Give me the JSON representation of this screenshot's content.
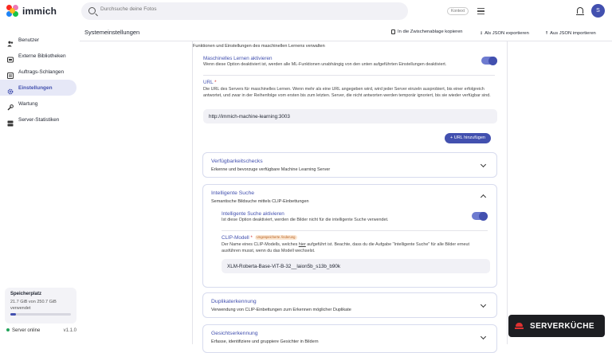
{
  "app": {
    "name": "immich"
  },
  "search": {
    "placeholder": "Durchsuche deine Fotos",
    "badge": "Kontext"
  },
  "user": {
    "avatar_letter": "S"
  },
  "sidebar": {
    "items": [
      {
        "label": "Benutzer",
        "icon": "users-icon"
      },
      {
        "label": "Externe Bibliotheken",
        "icon": "library-icon"
      },
      {
        "label": "Auftrags-Schlangen",
        "icon": "queue-icon"
      },
      {
        "label": "Einstellungen",
        "icon": "gear-icon",
        "active": true
      },
      {
        "label": "Wartung",
        "icon": "wrench-icon"
      },
      {
        "label": "Server-Statistiken",
        "icon": "server-icon"
      }
    ],
    "storage": {
      "title": "Speicherplatz",
      "usage": "21.7 GiB von 250.7 GiB verwendet",
      "fraction": 0.087
    },
    "server": {
      "status": "Server online",
      "version": "v1.1.0"
    }
  },
  "header": {
    "title": "Systemeinstellungen",
    "copy_label": "In die Zwischenablage kopieren",
    "export_label": "Als JSON exportieren",
    "import_label": "Aus JSON importieren"
  },
  "ml": {
    "intro": "Funktionen und Einstellungen des maschinellen Lernens verwalten",
    "enable_title": "Maschinelles Lernen aktivieren",
    "enable_desc": "Wenn diese Option deaktiviert ist, werden alle ML-Funktionen unabhängig von den unten aufgeführten Einstellungen deaktiviert.",
    "url_title": "URL",
    "url_desc": "Die URL des Servers für maschinelles Lernen. Wenn mehr als eine URL angegeben wird, wird jeder Server einzeln ausprobiert, bis einer erfolgreich antwortet, und zwar in der Reihenfolge vom ersten bis zum letzten. Server, die nicht antworten werden temporär ignoriert, bis sie wieder verfügbar sind.",
    "url_value": "http://immich-machine-learning:3003",
    "add_url_label": "+ URL hinzufügen"
  },
  "cards": {
    "availability": {
      "title": "Verfügbarkeitschecks",
      "desc": "Erkenne und bevorzuge verfügbare Machine Learning Server"
    },
    "smart_search": {
      "title": "Intelligente Suche",
      "desc": "Semantische Bildsuche mittels CLIP-Einbettungen",
      "enable_title": "Intelligente Suche aktivieren",
      "enable_desc": "Ist diese Option deaktiviert, werden die Bilder nicht für die intelligente Suche verwendet.",
      "model_title": "CLIP-Modell",
      "unsaved": "Ungespeicherte Änderung",
      "model_desc_1": "Der Name eines CLIP-Modells, welches ",
      "model_desc_link": "hier",
      "model_desc_2": " aufgeführt ist. Beachte, dass du die Aufgabe \"Intelligente Suche\" für alle Bilder erneut ausführen musst, wenn du das Modell wechselst.",
      "model_value": "XLM-Roberta-Base-ViT-B-32__laion5b_s13b_b90k"
    },
    "duplicates": {
      "title": "Duplikaterkennung",
      "desc": "Verwendung von CLIP-Einbettungen zum Erkennen möglicher Duplikate"
    },
    "faces": {
      "title": "Gesichtserkennung",
      "desc": "Erfasse, identifiziere und gruppiere Gesichter in Bildern"
    }
  },
  "banner": {
    "text": "SERVERKÜCHE"
  },
  "colors": {
    "accent": "#4250af",
    "banner_bg": "#1d1e22",
    "banner_icon": "#e03131",
    "online": "#22a35a"
  }
}
